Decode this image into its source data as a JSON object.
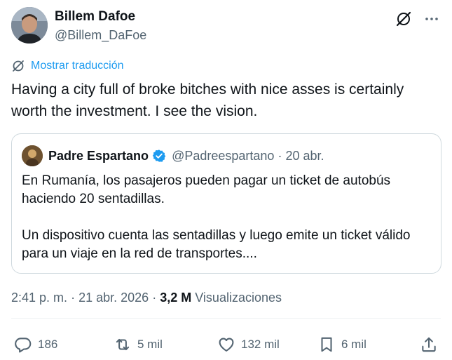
{
  "author": {
    "display_name": "Billem Dafoe",
    "handle": "@Billem_DaFoe"
  },
  "translate_label": "Mostrar traducción",
  "tweet_text": "Having a city full of broke bitches with nice asses is certainly worth the investment. I see the vision.",
  "quoted": {
    "display_name": "Padre Espartano",
    "handle": "@Padreespartano",
    "separator": "·",
    "date": "20 abr.",
    "paragraphs": [
      "En Rumanía, los pasajeros pueden pagar un ticket de autobús haciendo 20 sentadillas.",
      "Un dispositivo cuenta las sentadillas y luego emite un ticket válido para un viaje en la red de transportes...."
    ]
  },
  "meta": {
    "time": "2:41 p. m.",
    "dot1": "·",
    "date": "21 abr. 2026",
    "dot2": "·",
    "views_count": "3,2 M",
    "views_label": "Visualizaciones"
  },
  "actions": {
    "replies": "186",
    "reposts": "5 mil",
    "likes": "132 mil",
    "bookmarks": "6 mil"
  },
  "colors": {
    "text": "#0f1419",
    "secondary": "#536471",
    "link": "#1d9bf0",
    "border": "#cfd9de",
    "verified": "#1d9bf0"
  },
  "icons": [
    "grok-icon",
    "more-icon",
    "translate-icon",
    "verified-badge-icon",
    "reply-icon",
    "repost-icon",
    "like-icon",
    "bookmark-icon",
    "share-icon"
  ]
}
